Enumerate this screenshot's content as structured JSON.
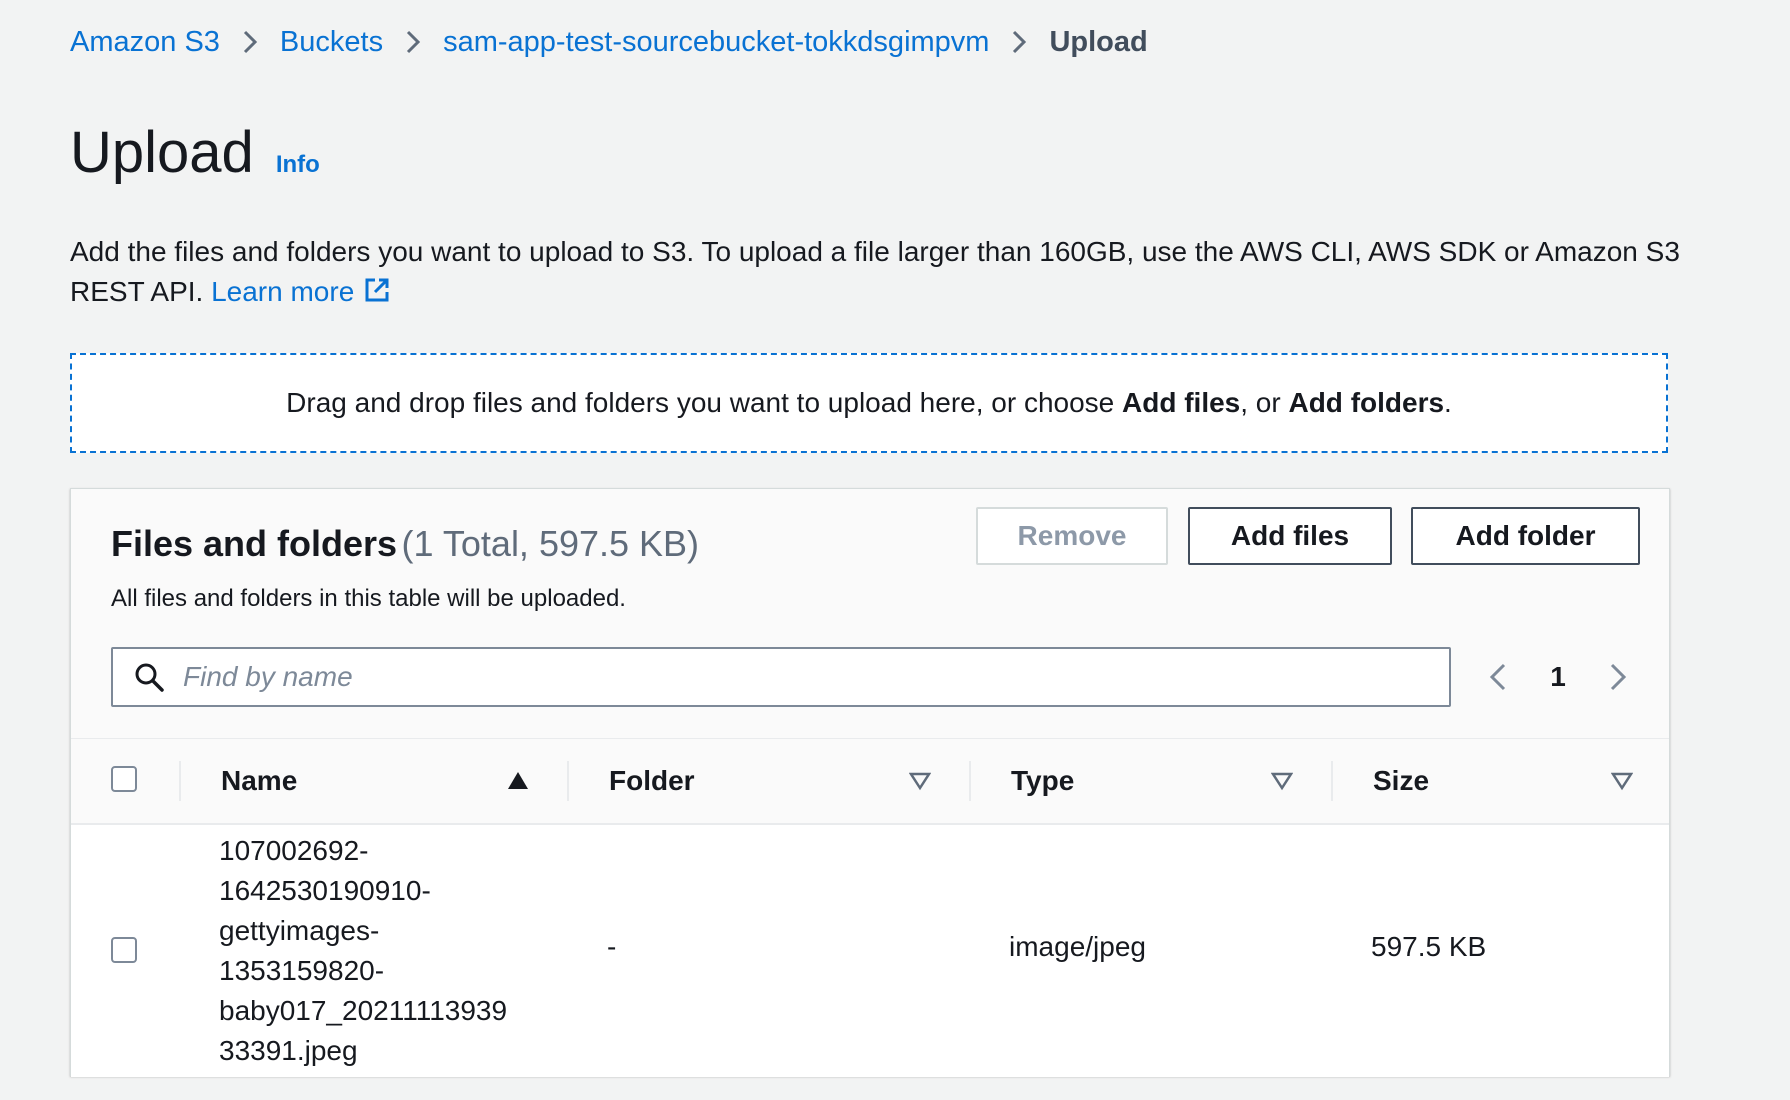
{
  "breadcrumb": {
    "items": [
      "Amazon S3",
      "Buckets",
      "sam-app-test-sourcebucket-tokkdsgimpvm"
    ],
    "current": "Upload"
  },
  "header": {
    "title": "Upload",
    "info": "Info"
  },
  "description": {
    "text": "Add the files and folders you want to upload to S3. To upload a file larger than 160GB, use the AWS CLI, AWS SDK or Amazon S3 REST API. ",
    "learn_more": "Learn more"
  },
  "dropzone": {
    "prefix": "Drag and drop files and folders you want to upload here, or choose ",
    "add_files": "Add files",
    "middle": ", or ",
    "add_folders": "Add folders",
    "suffix": "."
  },
  "files_panel": {
    "title": "Files and folders",
    "count": "(1 Total, 597.5 KB)",
    "subtitle": "All files and folders in this table will be uploaded.",
    "remove_label": "Remove",
    "add_files_label": "Add files",
    "add_folder_label": "Add folder",
    "search_placeholder": "Find by name",
    "page": "1",
    "columns": [
      "Name",
      "Folder",
      "Type",
      "Size"
    ],
    "rows": [
      {
        "name": "107002692-1642530190910-gettyimages-1353159820-baby017_2021111393933391.jpeg",
        "name_lines": [
          "107002692-",
          "1642530190910-",
          "gettyimages-",
          "1353159820-",
          "baby017_20211113939",
          "33391.jpeg"
        ],
        "folder": "-",
        "type": "image/jpeg",
        "size": "597.5 KB"
      }
    ]
  },
  "colors": {
    "link": "#0972d3",
    "background": "#f2f3f3",
    "text": "#16191f"
  },
  "icons": {
    "breadcrumb_separator": "chevron-right-icon",
    "external_link": "external-link-icon",
    "search": "search-icon",
    "sort_ascending": "caret-up-filled-icon",
    "sort_unsorted": "caret-down-outline-icon",
    "pager_prev": "chevron-left-icon",
    "pager_next": "chevron-right-icon"
  }
}
